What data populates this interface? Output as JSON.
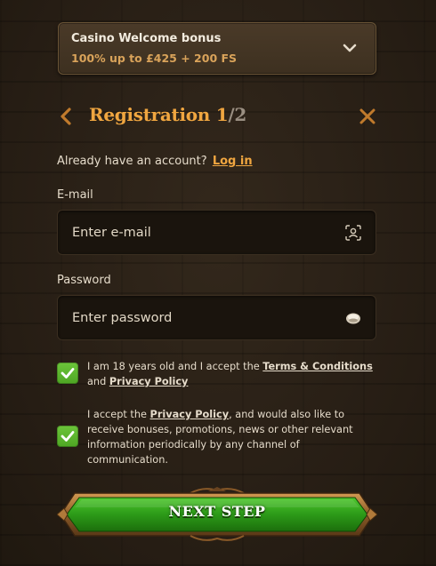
{
  "bonus": {
    "title": "Casino Welcome bonus",
    "subtitle": "100% up to £425 + 200 FS"
  },
  "header": {
    "title": "Registration",
    "step_current": "1",
    "step_sep_total": "/2"
  },
  "account": {
    "prompt": "Already have an account?",
    "login_label": "Log in"
  },
  "email": {
    "label": "E-mail",
    "placeholder": "Enter e-mail",
    "value": ""
  },
  "password": {
    "label": "Password",
    "placeholder": "Enter password",
    "value": ""
  },
  "consents": [
    {
      "checked": true,
      "text_1": "I am 18 years old and I accept the ",
      "link_1": "Terms & Conditions",
      "text_2": " and ",
      "link_2": "Privacy Policy"
    },
    {
      "checked": true,
      "text_1": "I accept the ",
      "link_1": "Privacy Policy",
      "text_2": ", and would also like to receive bonuses, promotions, news or other relevant information periodically by any channel of communication."
    }
  ],
  "next_button": {
    "label": "NEXT STEP"
  },
  "colors": {
    "accent": "#f0a640",
    "check_green": "#5bb42e",
    "button_green": "#2f9a1c"
  }
}
